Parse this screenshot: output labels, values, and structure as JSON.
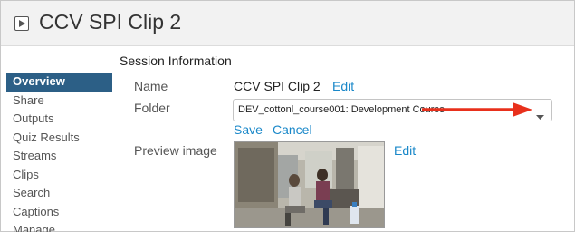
{
  "header": {
    "title": "CCV SPI Clip 2",
    "icon": "play-icon"
  },
  "section_title": "Session Information",
  "sidebar": {
    "items": [
      {
        "label": "Overview",
        "active": true
      },
      {
        "label": "Share"
      },
      {
        "label": "Outputs"
      },
      {
        "label": "Quiz Results"
      },
      {
        "label": "Streams"
      },
      {
        "label": "Clips"
      },
      {
        "label": "Search"
      },
      {
        "label": "Captions"
      },
      {
        "label": "Manage"
      }
    ]
  },
  "fields": {
    "name": {
      "label": "Name",
      "value": "CCV SPI  Clip 2",
      "edit_label": "Edit"
    },
    "folder": {
      "label": "Folder",
      "selected": "DEV_cottonl_course001: Development Course",
      "save_label": "Save",
      "cancel_label": "Cancel"
    },
    "preview": {
      "label": "Preview image",
      "edit_label": "Edit"
    }
  },
  "colors": {
    "accent": "#2c5f86",
    "link": "#1a88c9",
    "annotation_arrow": "#e8301c"
  }
}
